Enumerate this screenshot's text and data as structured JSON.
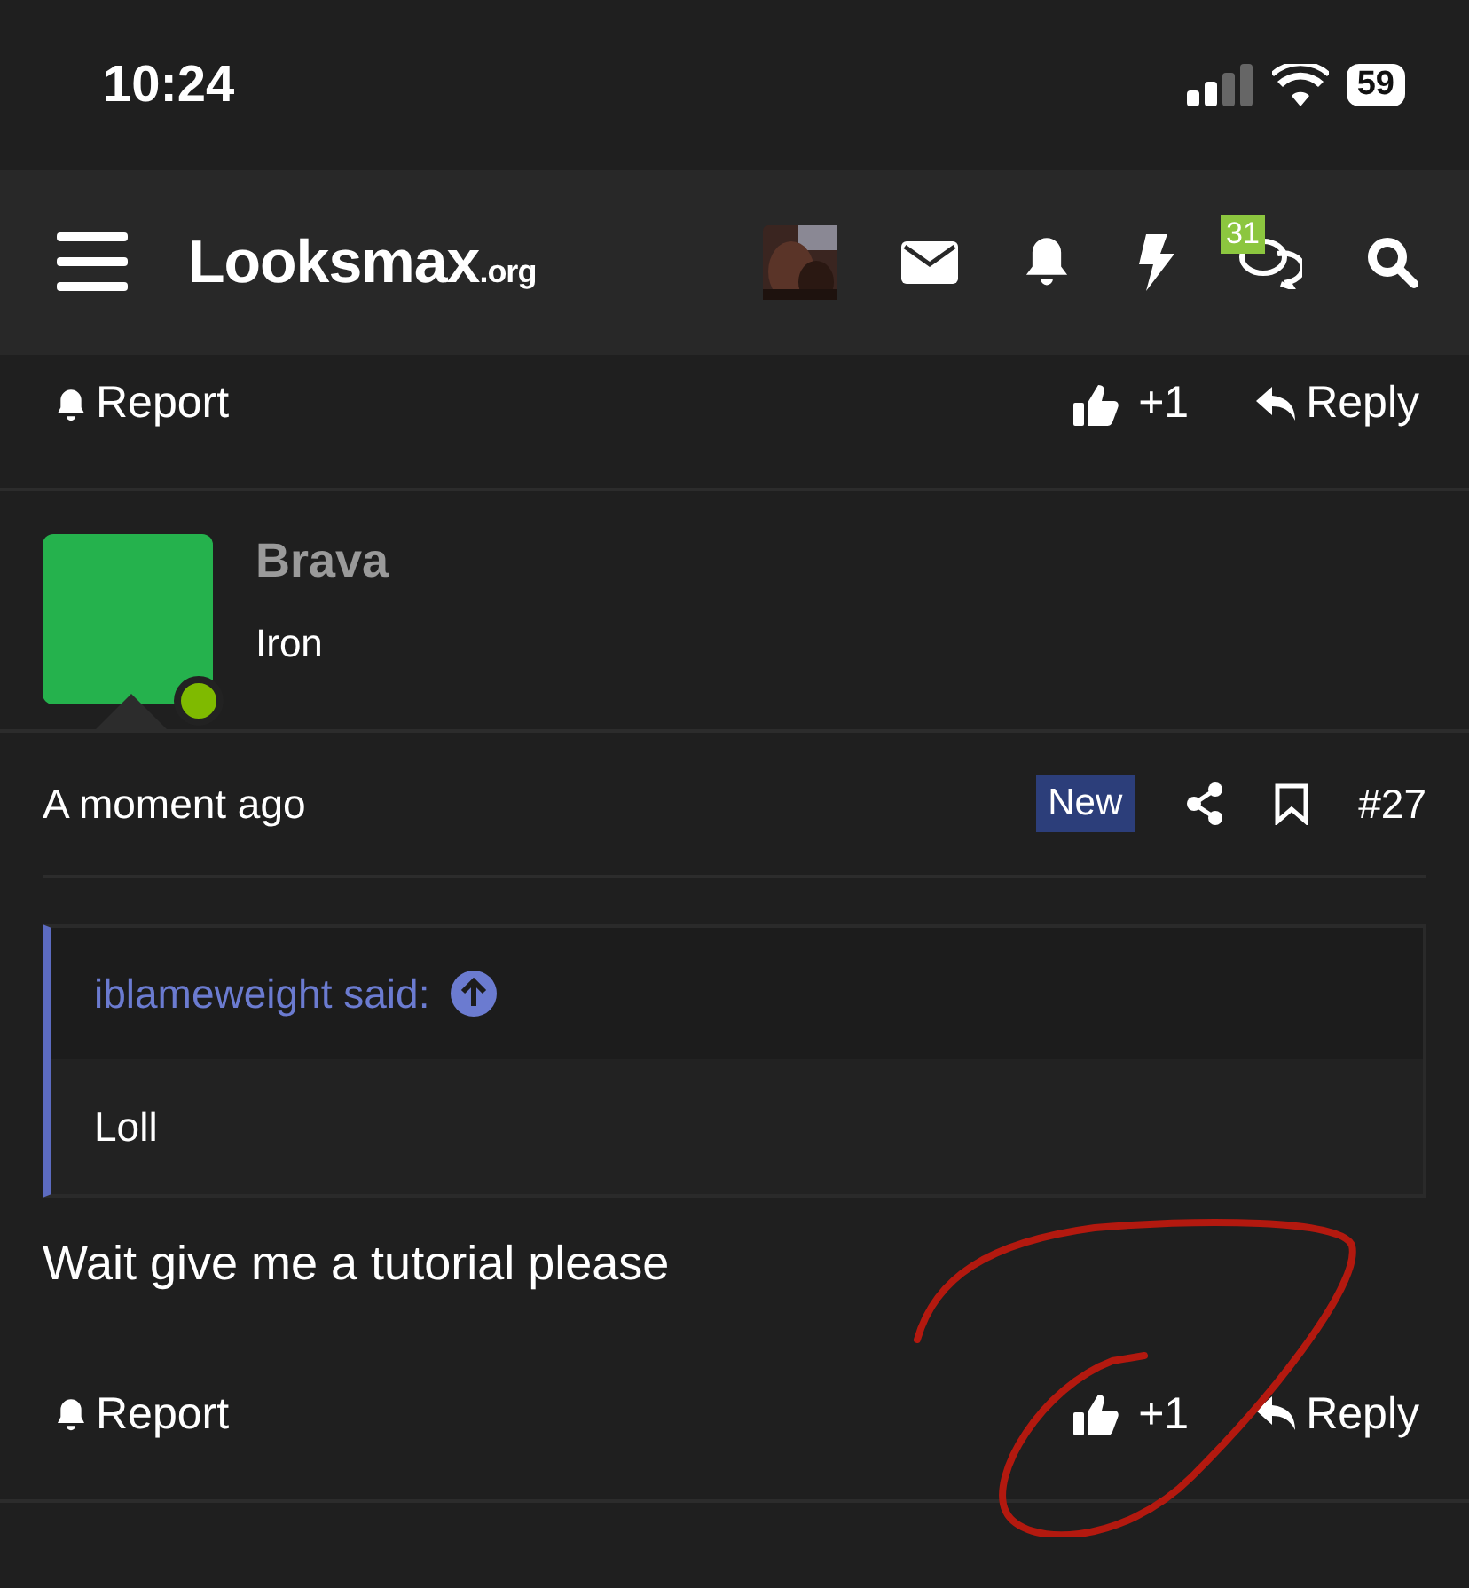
{
  "status_bar": {
    "time": "10:24",
    "battery": "59"
  },
  "nav": {
    "logo": {
      "name": "Looksmax",
      "suffix": ".org"
    },
    "conversations_badge": "31"
  },
  "previous_post_actions": {
    "report": "Report",
    "like": "+1",
    "reply": "Reply"
  },
  "post": {
    "user": {
      "name": "Brava",
      "title": "Iron",
      "online": true
    },
    "time": "A moment ago",
    "new_label": "New",
    "number": "#27",
    "quote": {
      "author": "iblameweight said:",
      "text": "Loll"
    },
    "body": "Wait give me a tutorial please",
    "actions": {
      "report": "Report",
      "like": "+1",
      "reply": "Reply"
    }
  },
  "annotation": {
    "kind": "circle",
    "color": "#b3190f"
  }
}
